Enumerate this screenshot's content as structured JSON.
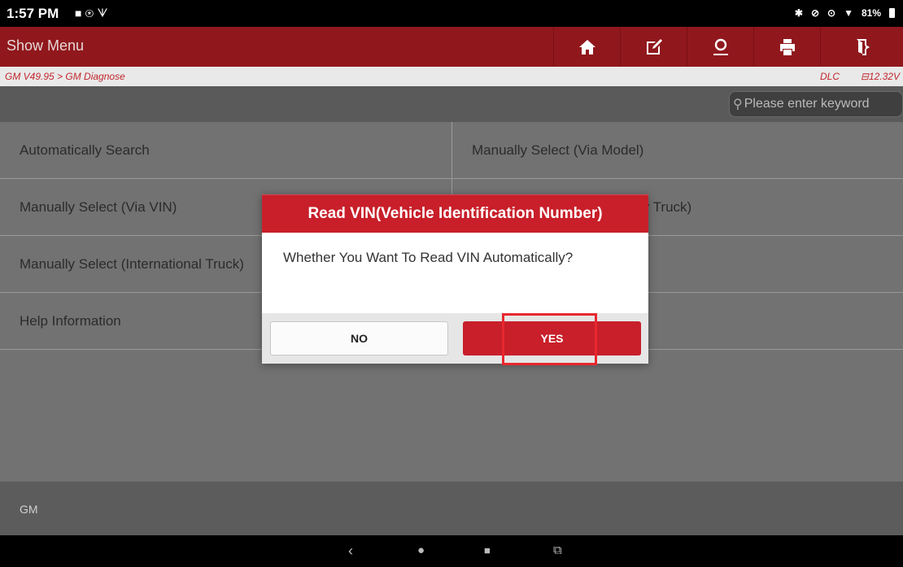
{
  "status_bar": {
    "time": "1:57 PM",
    "battery": "81%",
    "left_icons": [
      "notification-icon",
      "assistant-icon",
      "vpn-icon"
    ],
    "right_icons": [
      "bluetooth-icon",
      "mute-icon",
      "location-icon",
      "wifi-icon",
      "battery-icon"
    ]
  },
  "topbar": {
    "show_menu": "Show Menu",
    "buttons": [
      "home-icon",
      "edit-report-icon",
      "user-icon",
      "print-icon",
      "exit-icon"
    ]
  },
  "breadcrumb": {
    "path": "GM V49.95 > GM Diagnose",
    "dlc": "DLC",
    "voltage": "12.32V"
  },
  "search": {
    "placeholder": "Please enter keyword"
  },
  "menu": {
    "items": [
      "Automatically Search",
      "Manually Select (Via Model)",
      "Manually Select (Via VIN)",
      "Manually Select (Heavy Duty Truck)",
      "Manually Select (International Truck)",
      "",
      "Help Information",
      ""
    ]
  },
  "footer": {
    "label": "GM"
  },
  "dialog": {
    "title": "Read VIN(Vehicle Identification Number)",
    "message": "Whether You Want To Read VIN Automatically?",
    "no_label": "NO",
    "yes_label": "YES"
  },
  "colors": {
    "brand_red": "#c81f2a",
    "topbar_red": "#90181d",
    "highlight": "#e8282e"
  }
}
